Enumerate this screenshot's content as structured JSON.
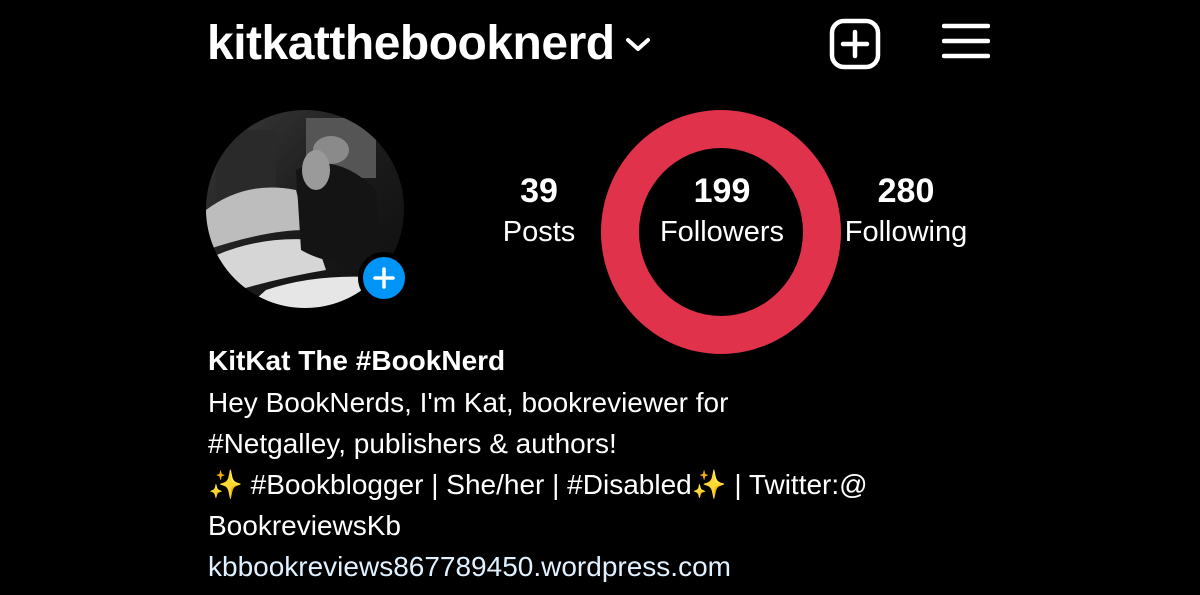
{
  "header": {
    "username": "kitkatthebooknerd",
    "switch_account_icon": "chevron-down-icon",
    "new_post_icon": "plus-square-icon",
    "menu_icon": "hamburger-menu-icon"
  },
  "profile": {
    "avatar_icon": "profile-photo",
    "add_story_icon": "plus-icon"
  },
  "stats": [
    {
      "value": "39",
      "label": "Posts"
    },
    {
      "value": "199",
      "label": "Followers"
    },
    {
      "value": "280",
      "label": "Following"
    }
  ],
  "annotation": {
    "color": "#e0324a",
    "shape": "ring-around-followers"
  },
  "bio": {
    "display_name": "KitKat The #BookNerd",
    "line1": "Hey BookNerds, I'm Kat, bookreviewer for",
    "line2": "#Netgalley, publishers & authors!",
    "line3_spark": "✨",
    "line3_text": " #Bookblogger | She/her | #Disabled",
    "line3_spark2": "✨",
    "line3_tail": "  | Twitter:@",
    "line4": "BookreviewsKb",
    "website": "kbbookreviews867789450.wordpress.com"
  },
  "colors": {
    "background": "#000000",
    "accent_blue": "#0095f6",
    "highlight_red": "#e0324a",
    "text": "#ffffff"
  }
}
